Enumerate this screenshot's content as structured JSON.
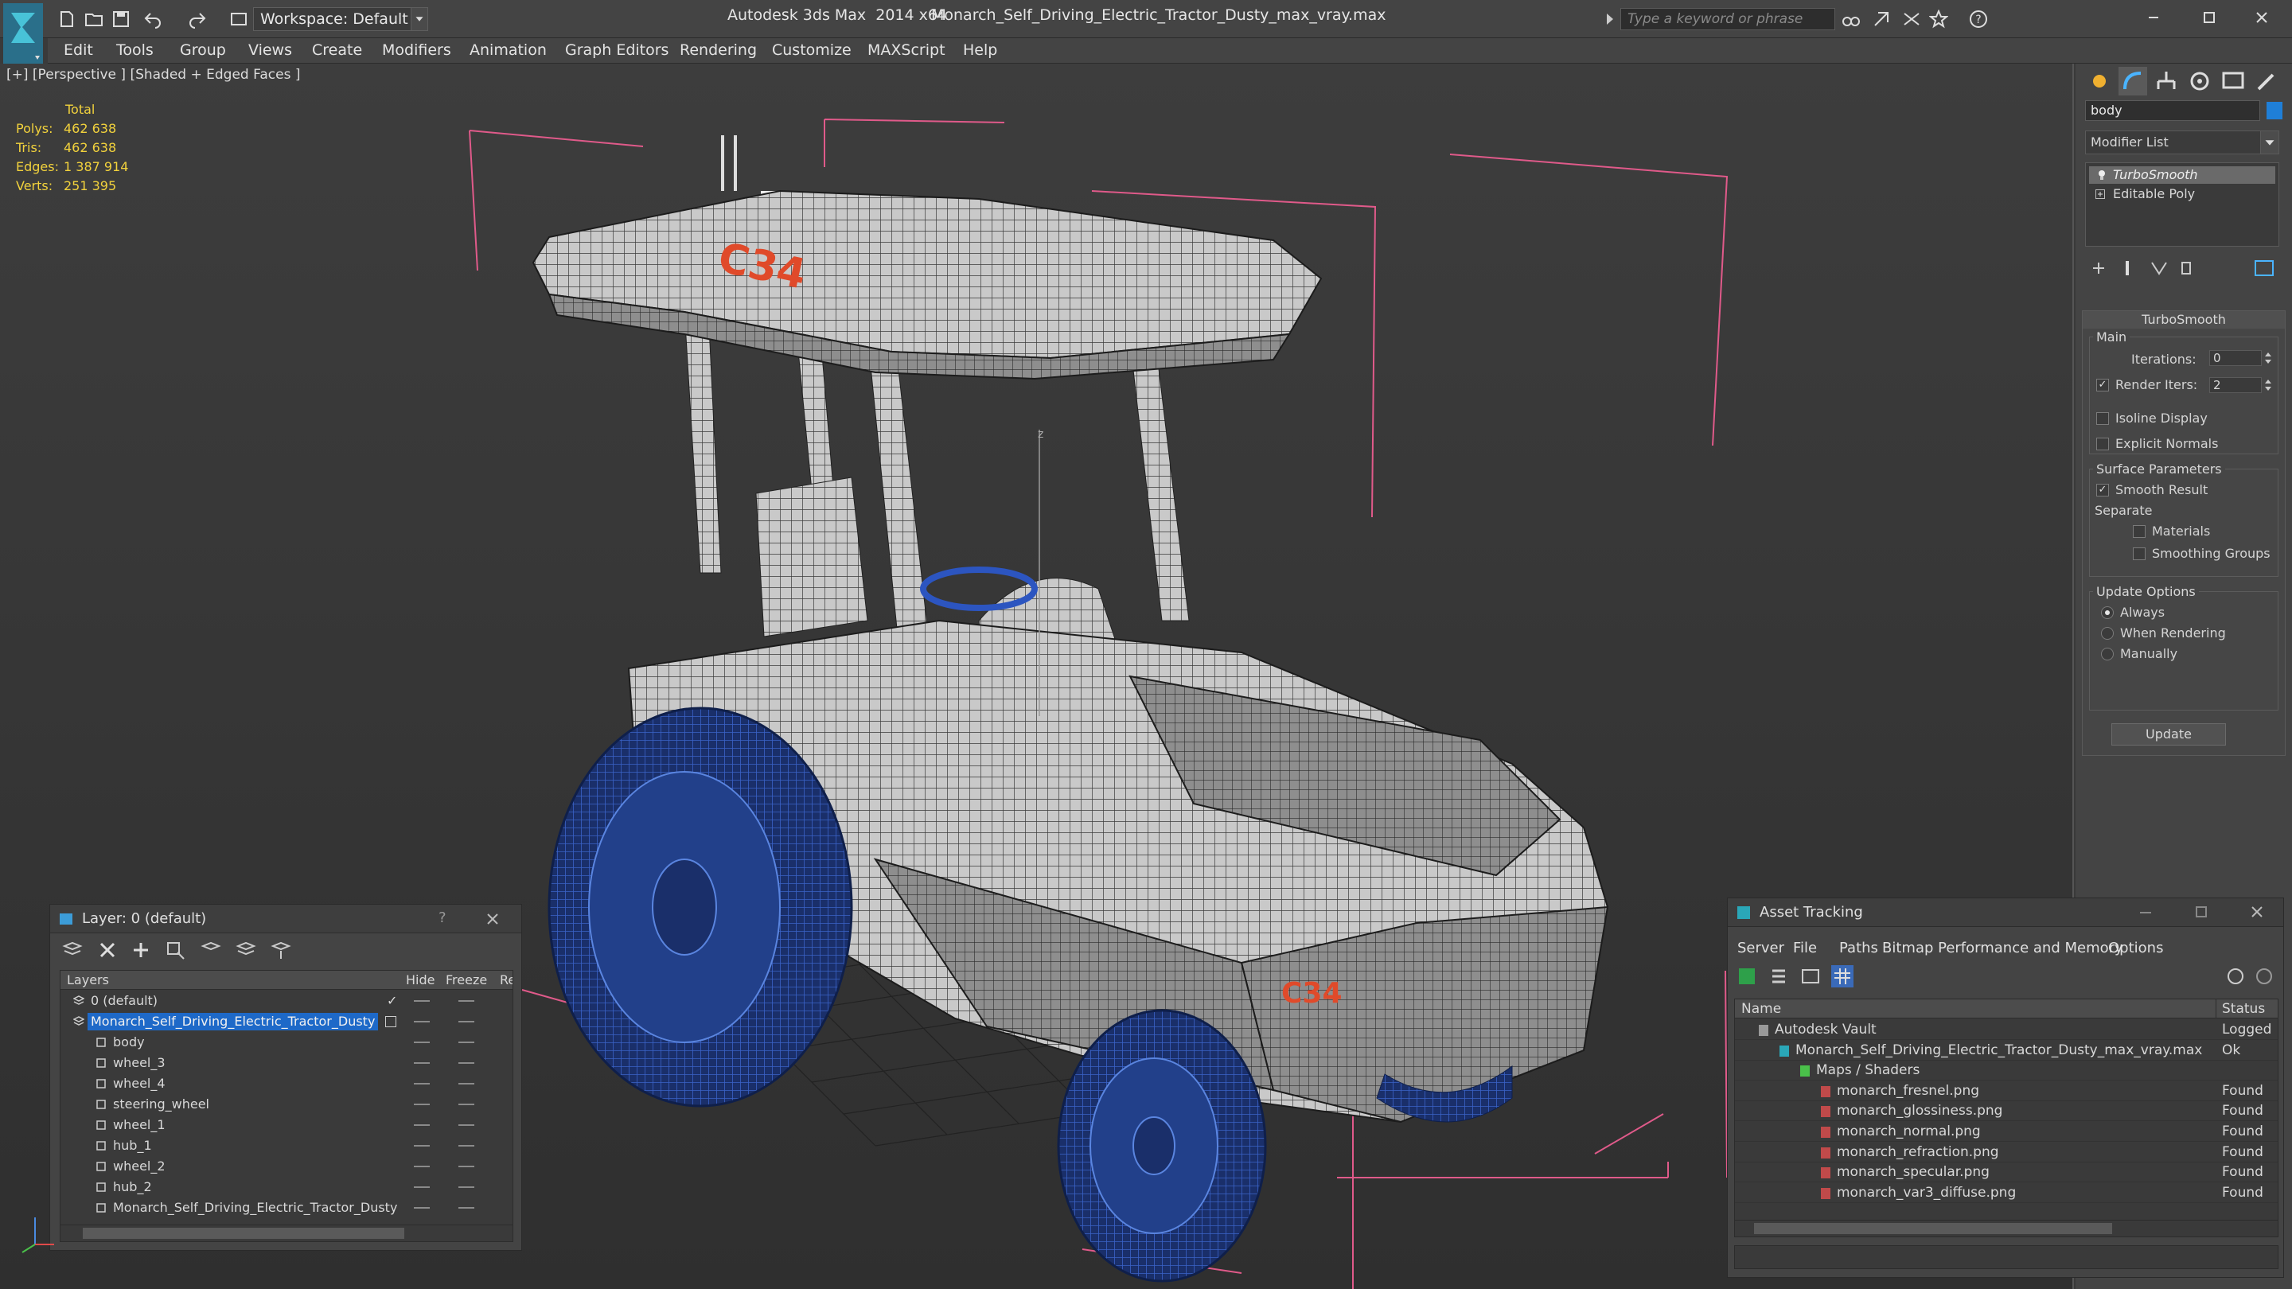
{
  "titlebar": {
    "workspace": "Workspace: Default",
    "app_title": "Autodesk 3ds Max  2014 x64",
    "file_title": "Monarch_Self_Driving_Electric_Tractor_Dusty_max_vray.max",
    "search_placeholder": "Type a keyword or phrase"
  },
  "menu": [
    "Edit",
    "Tools",
    "Group",
    "Views",
    "Create",
    "Modifiers",
    "Animation",
    "Graph Editors",
    "Rendering",
    "Customize",
    "MAXScript",
    "Help"
  ],
  "viewport": {
    "label": "[+] [Perspective ] [Shaded + Edged Faces ]",
    "stats": {
      "header": "Total",
      "rows": [
        {
          "label": "Polys:",
          "value": "462 638"
        },
        {
          "label": "Tris:",
          "value": "462 638"
        },
        {
          "label": "Edges:",
          "value": "1 387 914"
        },
        {
          "label": "Verts:",
          "value": "251 395"
        }
      ]
    },
    "decal_text": "C34",
    "axis_label": "z"
  },
  "command_panel": {
    "object_name": "body",
    "object_color": "#1f7fd8",
    "modifier_list": "Modifier List",
    "stack": [
      "TurboSmooth",
      "Editable Poly"
    ],
    "rollout_title": "TurboSmooth",
    "main_group": "Main",
    "iterations_label": "Iterations:",
    "iterations_value": "0",
    "render_iters_label": "Render Iters:",
    "render_iters_value": "2",
    "render_iters_checked": true,
    "isoline_label": "Isoline Display",
    "explicit_normals_label": "Explicit Normals",
    "surface_group": "Surface Parameters",
    "smooth_result_label": "Smooth Result",
    "separate_label": "Separate",
    "materials_label": "Materials",
    "smoothing_groups_label": "Smoothing Groups",
    "update_group": "Update Options",
    "always_label": "Always",
    "when_rendering_label": "When Rendering",
    "manually_label": "Manually",
    "update_button": "Update"
  },
  "layer_window": {
    "title": "Layer: 0 (default)",
    "help": "?",
    "columns": {
      "layers": "Layers",
      "hide": "Hide",
      "freeze": "Freeze",
      "render": "Re"
    },
    "rows": [
      {
        "name": "0 (default)",
        "level": 0,
        "type": "layer",
        "selected": false
      },
      {
        "name": "Monarch_Self_Driving_Electric_Tractor_Dusty",
        "level": 0,
        "type": "layer",
        "selected": true
      },
      {
        "name": "body",
        "level": 1,
        "type": "object",
        "selected": false
      },
      {
        "name": "wheel_3",
        "level": 1,
        "type": "object",
        "selected": false
      },
      {
        "name": "wheel_4",
        "level": 1,
        "type": "object",
        "selected": false
      },
      {
        "name": "steering_wheel",
        "level": 1,
        "type": "object",
        "selected": false
      },
      {
        "name": "wheel_1",
        "level": 1,
        "type": "object",
        "selected": false
      },
      {
        "name": "hub_1",
        "level": 1,
        "type": "object",
        "selected": false
      },
      {
        "name": "wheel_2",
        "level": 1,
        "type": "object",
        "selected": false
      },
      {
        "name": "hub_2",
        "level": 1,
        "type": "object",
        "selected": false
      },
      {
        "name": "Monarch_Self_Driving_Electric_Tractor_Dusty",
        "level": 1,
        "type": "object",
        "selected": false
      }
    ]
  },
  "asset_window": {
    "title": "Asset Tracking",
    "menu": [
      "Server",
      "File",
      "Paths",
      "Bitmap Performance and Memory",
      "Options"
    ],
    "columns": {
      "name": "Name",
      "status": "Status"
    },
    "rows": [
      {
        "name": "Autodesk Vault",
        "status": "Logged",
        "level": 0,
        "icon": "vault"
      },
      {
        "name": "Monarch_Self_Driving_Electric_Tractor_Dusty_max_vray.max",
        "status": "Ok",
        "level": 1,
        "icon": "max"
      },
      {
        "name": "Maps / Shaders",
        "status": "",
        "level": 2,
        "icon": "maps"
      },
      {
        "name": "monarch_fresnel.png",
        "status": "Found",
        "level": 3,
        "icon": "png"
      },
      {
        "name": "monarch_glossiness.png",
        "status": "Found",
        "level": 3,
        "icon": "png"
      },
      {
        "name": "monarch_normal.png",
        "status": "Found",
        "level": 3,
        "icon": "png"
      },
      {
        "name": "monarch_refraction.png",
        "status": "Found",
        "level": 3,
        "icon": "png"
      },
      {
        "name": "monarch_specular.png",
        "status": "Found",
        "level": 3,
        "icon": "png"
      },
      {
        "name": "monarch_var3_diffuse.png",
        "status": "Found",
        "level": 3,
        "icon": "png"
      }
    ]
  }
}
